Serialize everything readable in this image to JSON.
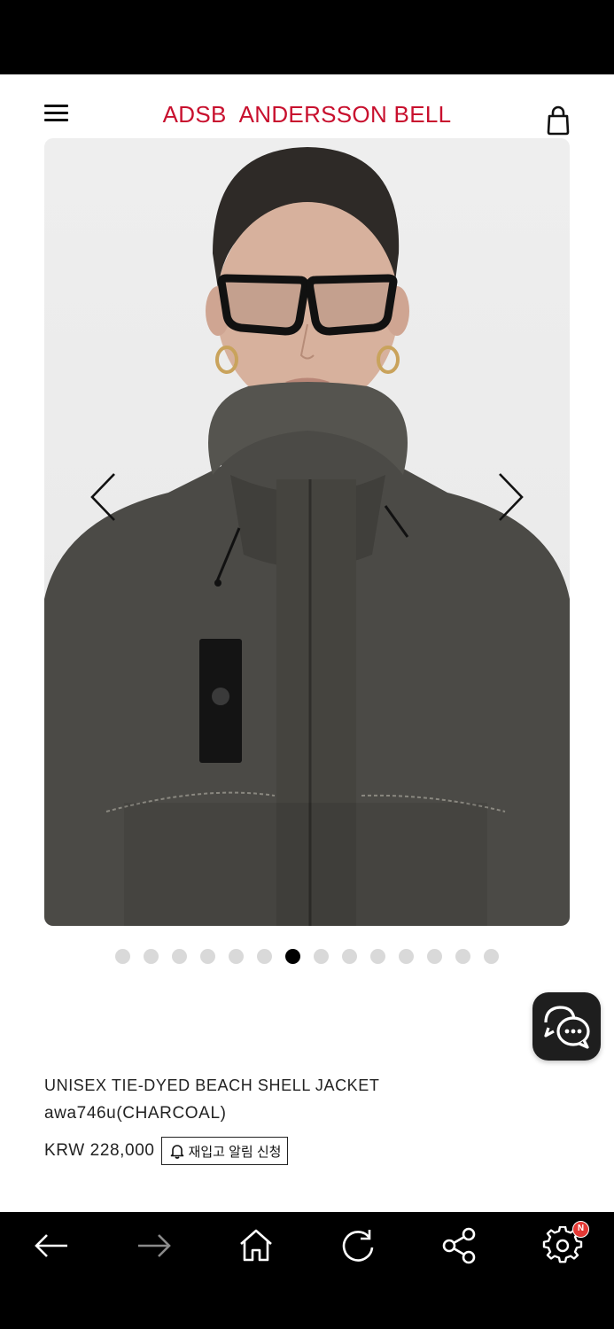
{
  "header": {
    "brand_left": "ADSB",
    "brand_right": "ANDERSSON BELL",
    "brand_color": "#c8102e",
    "menu_icon": "hamburger-menu-icon",
    "cart_icon": "shopping-bag-icon"
  },
  "gallery": {
    "image_description": "model in charcoal tie-dyed hooded shell jacket",
    "prev_icon": "chevron-left-icon",
    "next_icon": "chevron-right-icon",
    "slide_count": 14,
    "active_slide": 7
  },
  "chat": {
    "icon": "chat-bubble-icon"
  },
  "product": {
    "name": "UNISEX TIE-DYED BEACH SHELL JACKET",
    "code": "awa746u(CHARCOAL)",
    "price": "KRW 228,000",
    "restock_label": "재입고 알림 신청",
    "restock_icon": "bell-icon"
  },
  "bottom_nav": {
    "items": [
      {
        "name": "back",
        "icon": "arrow-left-icon"
      },
      {
        "name": "forward",
        "icon": "arrow-right-icon"
      },
      {
        "name": "home",
        "icon": "home-icon"
      },
      {
        "name": "refresh",
        "icon": "refresh-icon"
      },
      {
        "name": "share",
        "icon": "share-icon"
      },
      {
        "name": "settings",
        "icon": "gear-icon"
      }
    ],
    "settings_badge": "N",
    "badge_color": "#e53935"
  }
}
